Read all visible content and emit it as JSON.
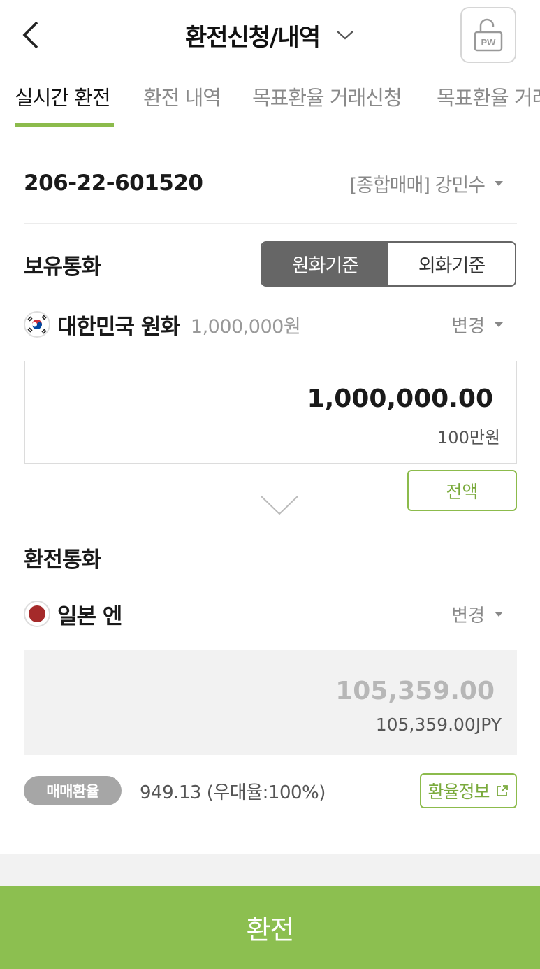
{
  "header": {
    "title": "환전신청/내역",
    "pw_label": "PW"
  },
  "tabs": [
    {
      "label": "실시간 환전",
      "active": true
    },
    {
      "label": "환전 내역",
      "active": false
    },
    {
      "label": "목표환율 거래신청",
      "active": false
    },
    {
      "label": "목표환율 거래",
      "active": false
    }
  ],
  "account": {
    "number": "206-22-601520",
    "owner": "[종합매매] 강민수"
  },
  "holding": {
    "label": "보유통화",
    "toggle": {
      "krw_basis": "원화기준",
      "fx_basis": "외화기준",
      "selected": "원화기준"
    },
    "currency_name": "대한민국 원화",
    "balance": "1,000,000원",
    "change_label": "변경",
    "amount": "1,000,000.00",
    "amount_korean": "100만원",
    "full_amount_label": "전액"
  },
  "target": {
    "label": "환전통화",
    "currency_name": "일본 엔",
    "change_label": "변경",
    "amount": "105,359.00",
    "amount_with_unit": "105,359.00JPY"
  },
  "rate": {
    "badge": "매매환율",
    "text": "949.13 (우대율:100%)",
    "info_label": "환율정보"
  },
  "actions": {
    "exchange_label": "환전"
  },
  "colors": {
    "accent_green": "#8cbf50",
    "toggle_dark": "#666666",
    "japan_red": "#a52a2a"
  }
}
